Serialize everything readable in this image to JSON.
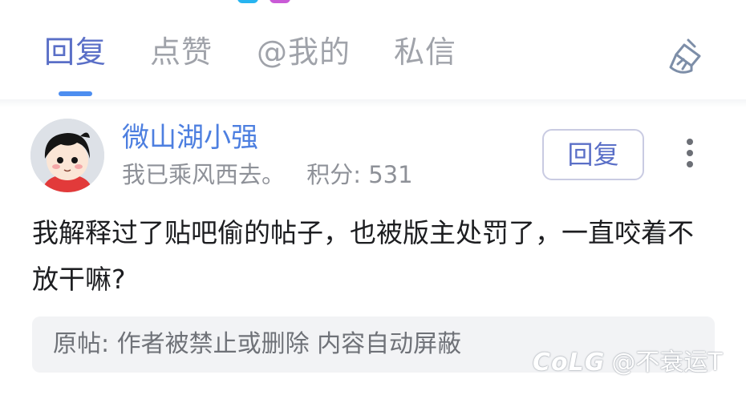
{
  "colors": {
    "accent": "#5a6fc7",
    "username": "#4d7fe0",
    "indicator": "#4d8ef0",
    "muted": "#a0a3aa",
    "text": "#1c1d20",
    "quote_bg": "#f2f3f5"
  },
  "tabs": [
    {
      "label": "回复",
      "active": true
    },
    {
      "label": "点赞",
      "active": false
    },
    {
      "label": "@我的",
      "active": false
    },
    {
      "label": "私信",
      "active": false
    }
  ],
  "toolbar": {
    "clean_icon": "broom-icon"
  },
  "post": {
    "username": "微山湖小强",
    "signature": "我已乘风西去。",
    "score": "积分: 531",
    "reply_label": "回复",
    "more_icon": "more-vertical-icon",
    "content": "我解释过了贴吧偷的帖子，也被版主处罚了，一直咬着不放干嘛?",
    "quote": "原帖:  作者被禁止或删除 内容自动屏蔽"
  },
  "watermark": {
    "logo": "CoLG",
    "text": "@不衰运T"
  }
}
